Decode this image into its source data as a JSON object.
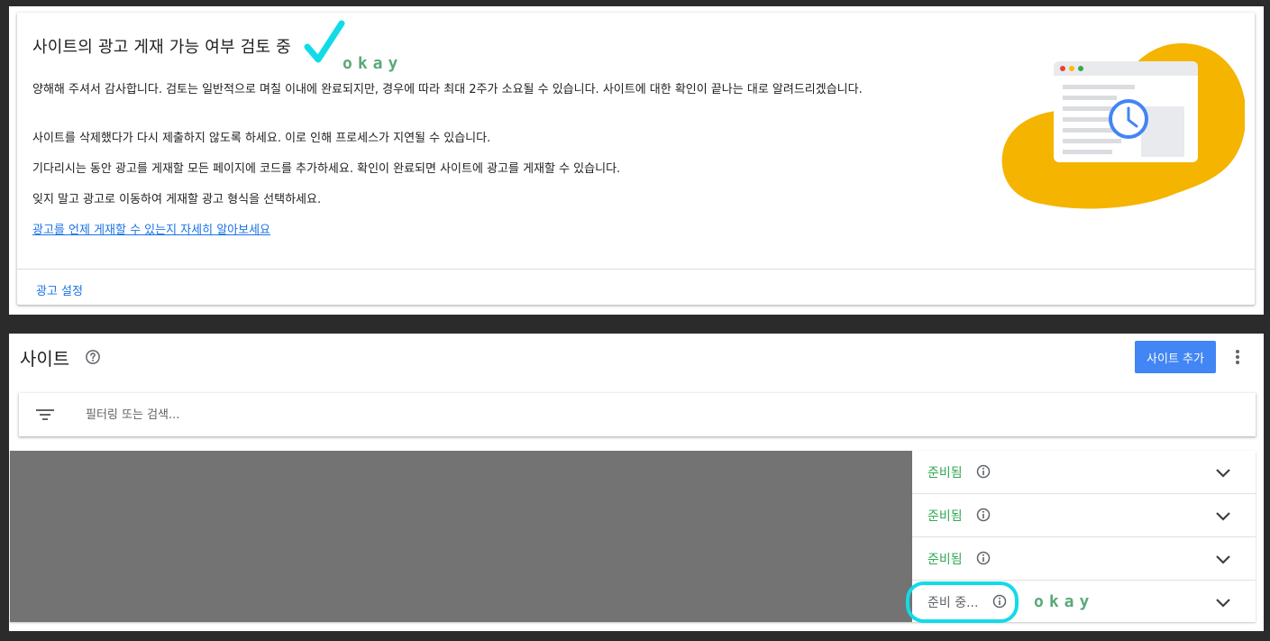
{
  "review": {
    "title": "사이트의 광고 게재 가능 여부 검토 중",
    "annotation": "okay",
    "paragraphs": [
      "양해해 주셔서 감사합니다. 검토는 일반적으로 며칠 이내에 완료되지만, 경우에 따라 최대 2주가 소요될 수 있습니다. 사이트에 대한 확인이 끝나는 대로 알려드리겠습니다.",
      "사이트를 삭제했다가 다시 제출하지 않도록 하세요. 이로 인해 프로세스가 지연될 수 있습니다.",
      "기다리시는 동안 광고를 게재할 모든 페이지에 코드를 추가하세요. 확인이 완료되면 사이트에 광고를 게재할 수 있습니다.",
      "잊지 말고 광고로 이동하여 게재할 광고 형식을 선택하세요."
    ],
    "learn_more_link": "광고를 언제 게재할 수 있는지 자세히 알아보세요",
    "ads_settings_link": "광고 설정"
  },
  "sites": {
    "title": "사이트",
    "add_site_label": "사이트 추가",
    "filter_placeholder": "필터링 또는 검색...",
    "annotation": "okay",
    "rows": [
      {
        "status": "준비됨",
        "state": "ready"
      },
      {
        "status": "준비됨",
        "state": "ready"
      },
      {
        "status": "준비됨",
        "state": "ready"
      },
      {
        "status": "준비 중...",
        "state": "pending"
      }
    ]
  },
  "colors": {
    "accent_blue": "#4285f4",
    "link_blue": "#1a73e8",
    "ready_green": "#34a853",
    "illustration_yellow": "#f4b400",
    "highlight_cyan": "#12dbe8",
    "annotation_green": "#5aa878"
  },
  "icons": [
    "help-icon",
    "more-vert-icon",
    "filter-icon",
    "info-icon",
    "chevron-down-icon",
    "clock-icon"
  ]
}
